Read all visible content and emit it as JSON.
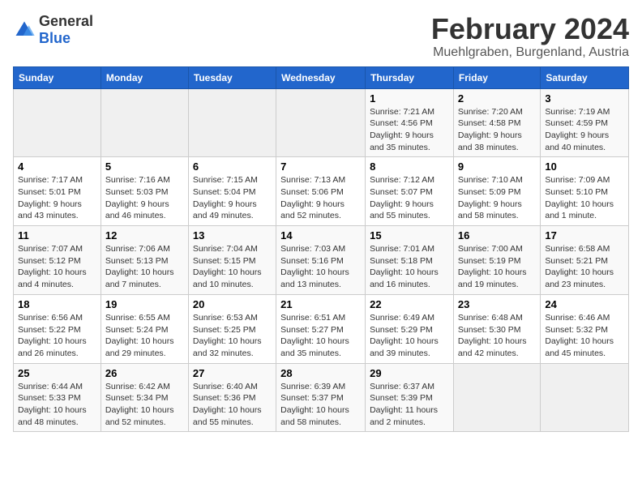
{
  "logo": {
    "general": "General",
    "blue": "Blue"
  },
  "title": "February 2024",
  "subtitle": "Muehlgraben, Burgenland, Austria",
  "headers": [
    "Sunday",
    "Monday",
    "Tuesday",
    "Wednesday",
    "Thursday",
    "Friday",
    "Saturday"
  ],
  "weeks": [
    [
      {
        "day": "",
        "info": ""
      },
      {
        "day": "",
        "info": ""
      },
      {
        "day": "",
        "info": ""
      },
      {
        "day": "",
        "info": ""
      },
      {
        "day": "1",
        "info": "Sunrise: 7:21 AM\nSunset: 4:56 PM\nDaylight: 9 hours\nand 35 minutes."
      },
      {
        "day": "2",
        "info": "Sunrise: 7:20 AM\nSunset: 4:58 PM\nDaylight: 9 hours\nand 38 minutes."
      },
      {
        "day": "3",
        "info": "Sunrise: 7:19 AM\nSunset: 4:59 PM\nDaylight: 9 hours\nand 40 minutes."
      }
    ],
    [
      {
        "day": "4",
        "info": "Sunrise: 7:17 AM\nSunset: 5:01 PM\nDaylight: 9 hours\nand 43 minutes."
      },
      {
        "day": "5",
        "info": "Sunrise: 7:16 AM\nSunset: 5:03 PM\nDaylight: 9 hours\nand 46 minutes."
      },
      {
        "day": "6",
        "info": "Sunrise: 7:15 AM\nSunset: 5:04 PM\nDaylight: 9 hours\nand 49 minutes."
      },
      {
        "day": "7",
        "info": "Sunrise: 7:13 AM\nSunset: 5:06 PM\nDaylight: 9 hours\nand 52 minutes."
      },
      {
        "day": "8",
        "info": "Sunrise: 7:12 AM\nSunset: 5:07 PM\nDaylight: 9 hours\nand 55 minutes."
      },
      {
        "day": "9",
        "info": "Sunrise: 7:10 AM\nSunset: 5:09 PM\nDaylight: 9 hours\nand 58 minutes."
      },
      {
        "day": "10",
        "info": "Sunrise: 7:09 AM\nSunset: 5:10 PM\nDaylight: 10 hours\nand 1 minute."
      }
    ],
    [
      {
        "day": "11",
        "info": "Sunrise: 7:07 AM\nSunset: 5:12 PM\nDaylight: 10 hours\nand 4 minutes."
      },
      {
        "day": "12",
        "info": "Sunrise: 7:06 AM\nSunset: 5:13 PM\nDaylight: 10 hours\nand 7 minutes."
      },
      {
        "day": "13",
        "info": "Sunrise: 7:04 AM\nSunset: 5:15 PM\nDaylight: 10 hours\nand 10 minutes."
      },
      {
        "day": "14",
        "info": "Sunrise: 7:03 AM\nSunset: 5:16 PM\nDaylight: 10 hours\nand 13 minutes."
      },
      {
        "day": "15",
        "info": "Sunrise: 7:01 AM\nSunset: 5:18 PM\nDaylight: 10 hours\nand 16 minutes."
      },
      {
        "day": "16",
        "info": "Sunrise: 7:00 AM\nSunset: 5:19 PM\nDaylight: 10 hours\nand 19 minutes."
      },
      {
        "day": "17",
        "info": "Sunrise: 6:58 AM\nSunset: 5:21 PM\nDaylight: 10 hours\nand 23 minutes."
      }
    ],
    [
      {
        "day": "18",
        "info": "Sunrise: 6:56 AM\nSunset: 5:22 PM\nDaylight: 10 hours\nand 26 minutes."
      },
      {
        "day": "19",
        "info": "Sunrise: 6:55 AM\nSunset: 5:24 PM\nDaylight: 10 hours\nand 29 minutes."
      },
      {
        "day": "20",
        "info": "Sunrise: 6:53 AM\nSunset: 5:25 PM\nDaylight: 10 hours\nand 32 minutes."
      },
      {
        "day": "21",
        "info": "Sunrise: 6:51 AM\nSunset: 5:27 PM\nDaylight: 10 hours\nand 35 minutes."
      },
      {
        "day": "22",
        "info": "Sunrise: 6:49 AM\nSunset: 5:29 PM\nDaylight: 10 hours\nand 39 minutes."
      },
      {
        "day": "23",
        "info": "Sunrise: 6:48 AM\nSunset: 5:30 PM\nDaylight: 10 hours\nand 42 minutes."
      },
      {
        "day": "24",
        "info": "Sunrise: 6:46 AM\nSunset: 5:32 PM\nDaylight: 10 hours\nand 45 minutes."
      }
    ],
    [
      {
        "day": "25",
        "info": "Sunrise: 6:44 AM\nSunset: 5:33 PM\nDaylight: 10 hours\nand 48 minutes."
      },
      {
        "day": "26",
        "info": "Sunrise: 6:42 AM\nSunset: 5:34 PM\nDaylight: 10 hours\nand 52 minutes."
      },
      {
        "day": "27",
        "info": "Sunrise: 6:40 AM\nSunset: 5:36 PM\nDaylight: 10 hours\nand 55 minutes."
      },
      {
        "day": "28",
        "info": "Sunrise: 6:39 AM\nSunset: 5:37 PM\nDaylight: 10 hours\nand 58 minutes."
      },
      {
        "day": "29",
        "info": "Sunrise: 6:37 AM\nSunset: 5:39 PM\nDaylight: 11 hours\nand 2 minutes."
      },
      {
        "day": "",
        "info": ""
      },
      {
        "day": "",
        "info": ""
      }
    ]
  ]
}
